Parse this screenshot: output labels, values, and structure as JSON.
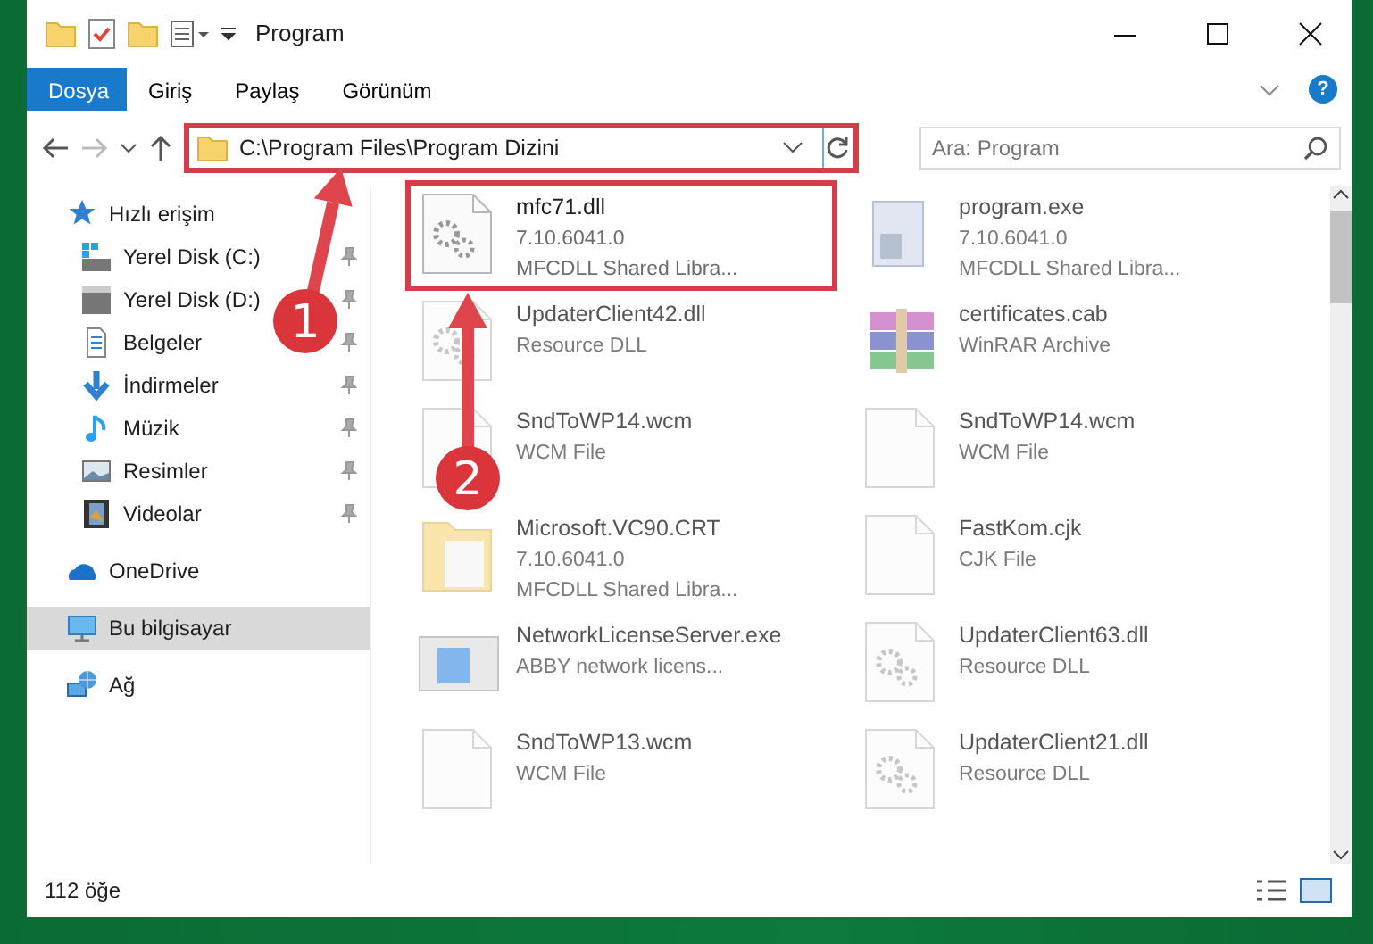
{
  "window": {
    "title": "Program"
  },
  "ribbon_tabs": [
    {
      "label": "Dosya",
      "selected": true
    },
    {
      "label": "Giriş",
      "selected": false
    },
    {
      "label": "Paylaş",
      "selected": false
    },
    {
      "label": "Görünüm",
      "selected": false
    }
  ],
  "help_button": {
    "label": "?"
  },
  "address_bar": {
    "path": "C:\\Program Files\\Program Dizini",
    "highlighted": true
  },
  "search": {
    "placeholder": "Ara: Program"
  },
  "sidebar": {
    "items": [
      {
        "label": "Hızlı erişim",
        "kind": "star",
        "pinned": false,
        "selected": false,
        "children": [
          {
            "label": "Yerel Disk (C:)",
            "kind": "drive-os",
            "pinned": true,
            "selected": false
          },
          {
            "label": "Yerel Disk (D:)",
            "kind": "drive",
            "pinned": true,
            "selected": false
          },
          {
            "label": "Belgeler",
            "kind": "document",
            "pinned": true,
            "selected": false
          },
          {
            "label": "İndirmeler",
            "kind": "download",
            "pinned": true,
            "selected": false
          },
          {
            "label": "Müzik",
            "kind": "music",
            "pinned": true,
            "selected": false
          },
          {
            "label": "Resimler",
            "kind": "picture",
            "pinned": true,
            "selected": false
          },
          {
            "label": "Videolar",
            "kind": "video",
            "pinned": true,
            "selected": false
          }
        ]
      },
      {
        "label": "OneDrive",
        "kind": "cloud",
        "pinned": false,
        "selected": false
      },
      {
        "label": "Bu bilgisayar",
        "kind": "computer",
        "pinned": false,
        "selected": true
      },
      {
        "label": "Ağ",
        "kind": "network",
        "pinned": false,
        "selected": false
      }
    ]
  },
  "files": [
    {
      "name": "mfc71.dll",
      "lines": [
        "7.10.6041.0",
        "MFCDLL Shared Libra..."
      ],
      "kind": "dll",
      "blurred": false,
      "highlighted": true
    },
    {
      "name": "program.exe",
      "lines": [
        "7.10.6041.0",
        "MFCDLL Shared Libra..."
      ],
      "kind": "exe",
      "blurred": true,
      "highlighted": false
    },
    {
      "name": "UpdaterClient42.dll",
      "lines": [
        "Resource DLL"
      ],
      "kind": "dll",
      "blurred": true,
      "highlighted": false
    },
    {
      "name": "certificates.cab",
      "lines": [
        "WinRAR Archive"
      ],
      "kind": "archive",
      "blurred": true,
      "highlighted": false
    },
    {
      "name": "SndToWP14.wcm",
      "lines": [
        "WCM File"
      ],
      "kind": "blank",
      "blurred": true,
      "highlighted": false
    },
    {
      "name": "SndToWP14.wcm",
      "lines": [
        "WCM File"
      ],
      "kind": "blank",
      "blurred": true,
      "highlighted": false
    },
    {
      "name": "Microsoft.VC90.CRT",
      "lines": [
        "7.10.6041.0",
        "MFCDLL Shared Libra..."
      ],
      "kind": "folder",
      "blurred": true,
      "highlighted": false
    },
    {
      "name": "FastKom.cjk",
      "lines": [
        "CJK File"
      ],
      "kind": "blank",
      "blurred": true,
      "highlighted": false
    },
    {
      "name": "NetworkLicenseServer.exe",
      "lines": [
        "ABBY network licens..."
      ],
      "kind": "app",
      "blurred": true,
      "highlighted": false
    },
    {
      "name": "UpdaterClient63.dll",
      "lines": [
        "Resource DLL"
      ],
      "kind": "dll",
      "blurred": true,
      "highlighted": false
    },
    {
      "name": "SndToWP13.wcm",
      "lines": [
        "WCM File"
      ],
      "kind": "blank",
      "blurred": true,
      "highlighted": false
    },
    {
      "name": "UpdaterClient21.dll",
      "lines": [
        "Resource DLL"
      ],
      "kind": "dll",
      "blurred": true,
      "highlighted": false
    }
  ],
  "status_bar": {
    "count": "112 öğe"
  },
  "annotations": [
    {
      "number": "1"
    },
    {
      "number": "2"
    }
  ]
}
